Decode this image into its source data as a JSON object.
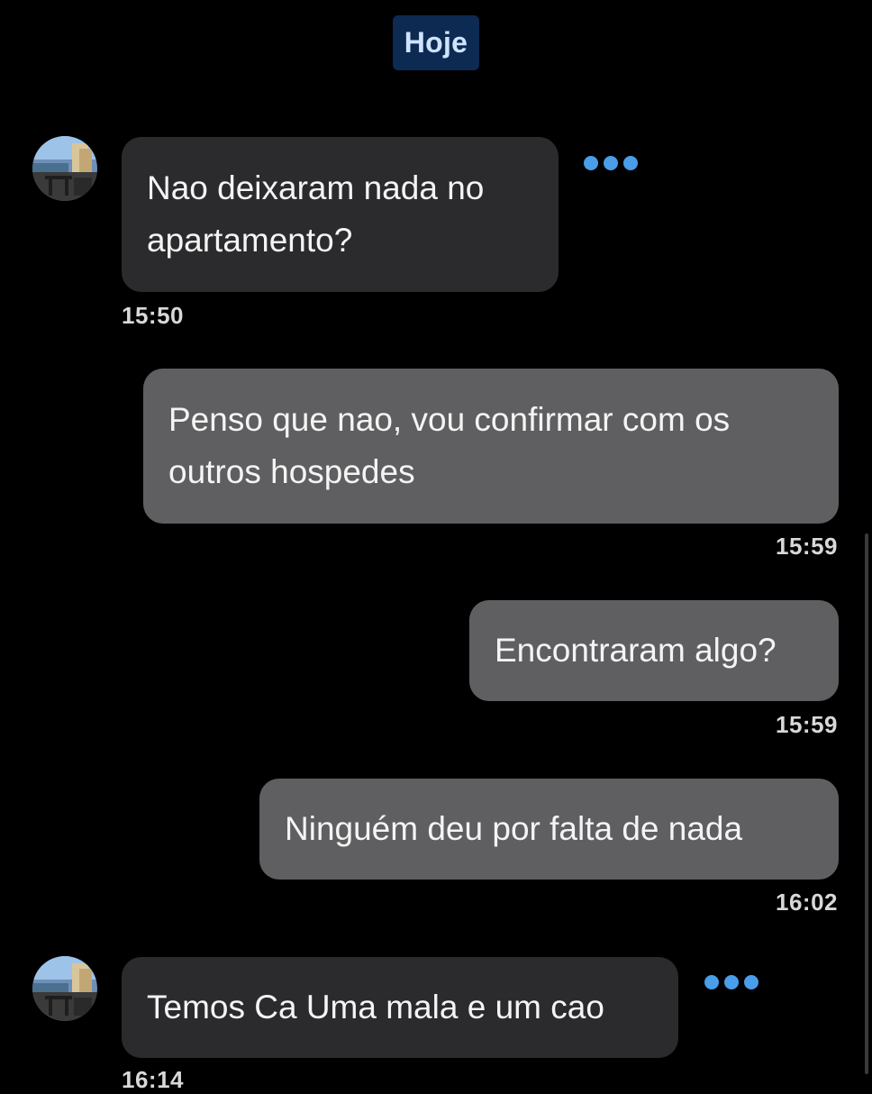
{
  "date_separator": "Hoje",
  "messages": [
    {
      "direction": "in",
      "text_lines": [
        "Nao deixaram nada no",
        "apartamento?"
      ],
      "time": "15:50"
    },
    {
      "direction": "out",
      "text_lines": [
        "Penso que nao, vou confirmar com os",
        "outros hospedes"
      ],
      "time": "15:59"
    },
    {
      "direction": "out",
      "text_lines": [
        "Encontraram algo?"
      ],
      "time": "15:59"
    },
    {
      "direction": "out",
      "text_lines": [
        "Ninguém deu por falta de nada"
      ],
      "time": "16:02"
    },
    {
      "direction": "in",
      "text_lines": [
        "Temos Ca Uma mala e um cao"
      ],
      "time": "16:14"
    }
  ],
  "icons": {
    "more": "more-options-icon",
    "avatar": "contact-avatar"
  },
  "colors": {
    "background": "#000000",
    "incoming_bubble": "#2b2b2d",
    "outgoing_bubble": "#5f5f61",
    "accent": "#4a9de8",
    "date_pill": "#0d2a52"
  }
}
